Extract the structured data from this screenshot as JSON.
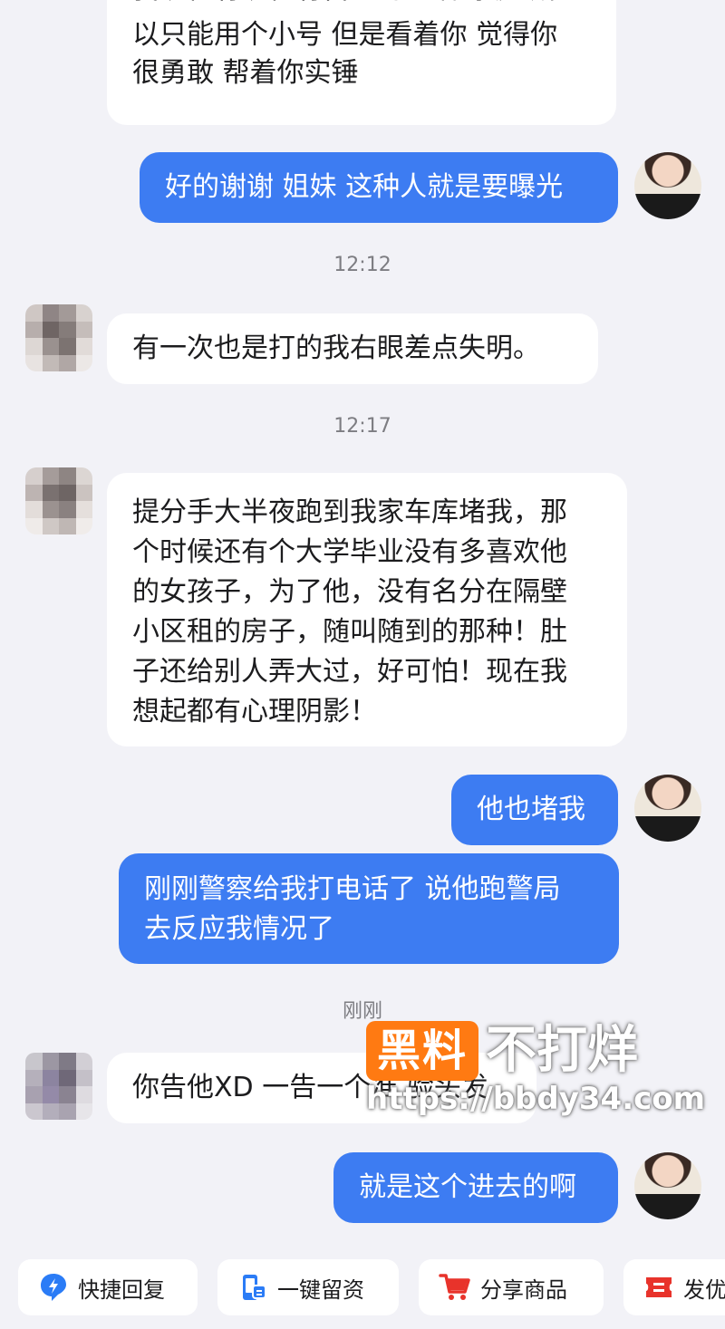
{
  "messages": {
    "m1_partial": "我现在有现在有自己的生活 家庭 所",
    "m1": "以只能用个小号 但是看着你 觉得你\n很勇敢 帮着你实锤",
    "m2": "好的谢谢 姐妹 这种人就是要曝光",
    "t1": "12:12",
    "m3": "有一次也是打的我右眼差点失明。",
    "t2": "12:17",
    "m4": "提分手大半夜跑到我家车库堵我，那\n个时候还有个大学毕业没有多喜欢他\n的女孩子，为了他，没有名分在隔壁\n小区租的房子，随叫随到的那种！肚\n子还给别人弄大过，好可怕！现在我\n想起都有心理阴影！",
    "m5": "他也堵我",
    "m6": "刚刚警察给我打电话了 说他跑警局\n去反应我情况了",
    "t3": "刚刚",
    "m7": "你告他XD 一告一个准 验头发",
    "m8": "就是这个进去的啊"
  },
  "quick_actions": {
    "a1": "快捷回复",
    "a2": "一键留资",
    "a3": "分享商品",
    "a4": "发优"
  },
  "icons": {
    "a1": "lightning-bubble-icon",
    "a2": "phone-form-icon",
    "a3": "cart-icon",
    "a4": "coupon-icon"
  },
  "watermark": {
    "badge": "黑料",
    "title": "不打烊",
    "url": "https://bbdy34.com"
  },
  "colors": {
    "outgoing_bubble": "#3d7cf2",
    "incoming_bubble": "#ffffff",
    "background": "#f2f2f7",
    "watermark_badge": "#ff7a12",
    "icon_blue": "#2b7cf6",
    "icon_red": "#e8332b"
  }
}
